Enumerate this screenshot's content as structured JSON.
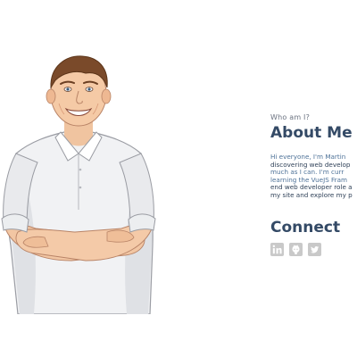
{
  "about": {
    "eyebrow": "Who am I?",
    "title": "About Me",
    "bio_lines": [
      "Hi everyone, I'm Martin",
      "discovering web develop",
      "much as I can. I'm curr",
      "learning the VueJS Fram",
      "end web developer role a",
      "my site and explore my p"
    ]
  },
  "connect": {
    "title": "Connect",
    "links": [
      {
        "icon": "linkedin-icon"
      },
      {
        "icon": "github-icon"
      },
      {
        "icon": "twitter-icon"
      }
    ]
  },
  "colors": {
    "heading": "#344a66",
    "eyebrow": "#6b7280",
    "bio": "#4e7298",
    "social_icon": "#c9c9c9"
  }
}
